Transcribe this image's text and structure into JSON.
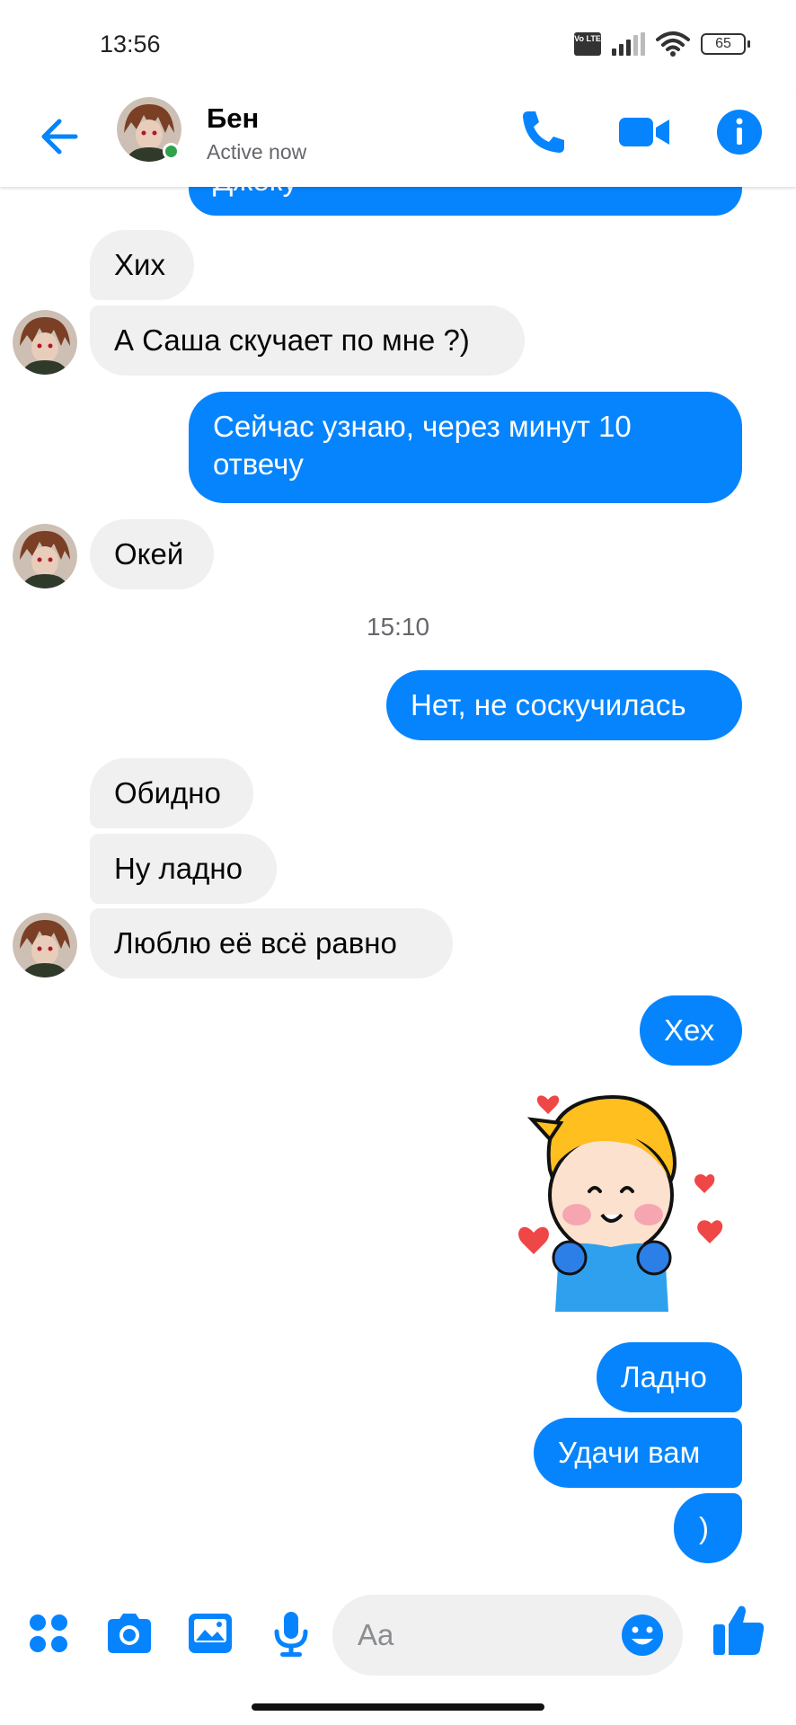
{
  "status_bar": {
    "time": "13:56",
    "battery": "65",
    "volte_label": "Vo LTE"
  },
  "header": {
    "name": "Бен",
    "status": "Active now"
  },
  "messages": {
    "m0": "Джеку",
    "m1": "Хих",
    "m2": "А Саша скучает по мне ?)",
    "m3_line1": "Сейчас узнаю, через минут 10",
    "m3_line2": "отвечу",
    "m4": "Окей",
    "timestamp": "15:10",
    "m5": "Нет, не соскучилась",
    "m6": "Обидно",
    "m7": "Ну ладно",
    "m8": "Люблю её всё равно",
    "m9": "Хех",
    "m10": "Ладно",
    "m11": "Удачи вам",
    "m12": ")"
  },
  "composer": {
    "placeholder": "Aa"
  },
  "colors": {
    "accent": "#0584FE",
    "incoming_bubble": "#F0F0F0",
    "online": "#31A24C"
  },
  "icons": [
    "back-arrow-icon",
    "phone-icon",
    "video-camera-icon",
    "info-icon",
    "menu-grid-icon",
    "camera-icon",
    "image-icon",
    "microphone-icon",
    "emoji-icon",
    "thumbs-up-icon"
  ]
}
